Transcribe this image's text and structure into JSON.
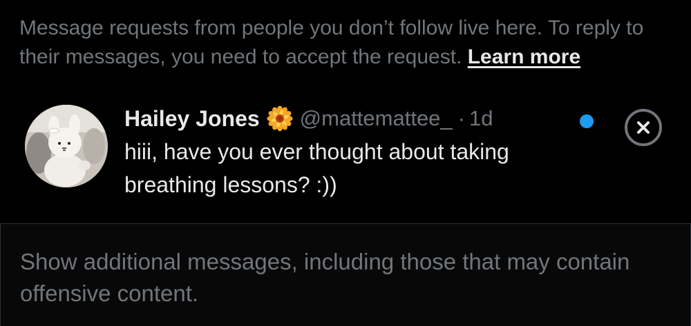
{
  "info": {
    "text": "Message requests from people you don’t follow live here. To reply to their messages, you need to accept the request.",
    "learn_more": "Learn more"
  },
  "request": {
    "name": "Hailey Jones",
    "name_emoji": "🌼",
    "name_emoji_icon": "flower-icon",
    "handle": "@mattemattee_",
    "separator": "·",
    "time": "1d",
    "message": "hiii, have you ever thought about taking breathing lessons? :))",
    "unread_color": "#1d9bf0"
  },
  "additional": {
    "text": "Show additional messages, including those that may contain offensive content."
  },
  "colors": {
    "background": "#000000",
    "primary_text": "#e7e9ea",
    "secondary_text": "#71767b",
    "accent": "#1d9bf0",
    "border": "#2f3336"
  }
}
